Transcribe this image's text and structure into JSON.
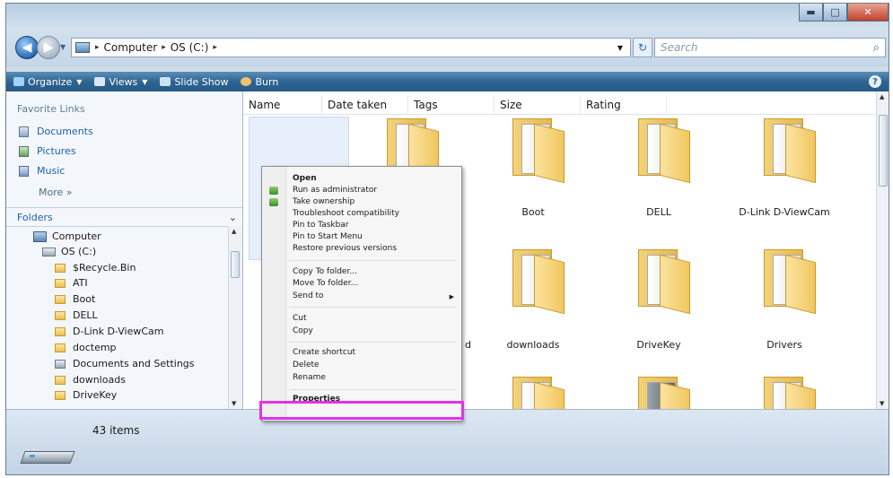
{
  "window": {
    "controls": {
      "minimize": "▬",
      "maximize": "□",
      "close": "✕"
    }
  },
  "address": {
    "back": "◀",
    "forward": "▶",
    "crumbs": [
      "Computer",
      "OS (C:)"
    ],
    "separator": "▸",
    "refresh": "↻",
    "search_placeholder": "Search",
    "search_icon": "⌕"
  },
  "toolbar": {
    "organize": "Organize",
    "views": "Views",
    "slideshow": "Slide Show",
    "burn": "Burn",
    "help": "?"
  },
  "sidebar": {
    "favorites_header": "Favorite Links",
    "favorites": [
      "Documents",
      "Pictures",
      "Music"
    ],
    "more": "More »",
    "folders_header": "Folders",
    "tree": [
      "Computer",
      "OS (C:)",
      "$Recycle.Bin",
      "ATI",
      "Boot",
      "DELL",
      "D-Link D-ViewCam",
      "doctemp",
      "Documents and Settings",
      "downloads",
      "DriveKey"
    ]
  },
  "columns": [
    "Name",
    "Date taken",
    "Tags",
    "Size",
    "Rating"
  ],
  "items": [
    {
      "row": 0,
      "col": 2,
      "label": "Boot"
    },
    {
      "row": 0,
      "col": 3,
      "label": "DELL"
    },
    {
      "row": 0,
      "col": 4,
      "label": "D-Link D-ViewCam"
    },
    {
      "row": 1,
      "col": 2,
      "label": "downloads"
    },
    {
      "row": 1,
      "col": 3,
      "label": "DriveKey"
    },
    {
      "row": 1,
      "col": 4,
      "label": "Drivers"
    }
  ],
  "partial_label": "d",
  "context_menu": {
    "open": "Open",
    "run_admin": "Run as administrator",
    "take_ownership": "Take ownership",
    "troubleshoot": "Troubleshoot compatibility",
    "pin_taskbar": "Pin to Taskbar",
    "pin_start": "Pin to Start Menu",
    "restore": "Restore previous versions",
    "copy_to": "Copy To folder...",
    "move_to": "Move To folder...",
    "send_to": "Send to",
    "cut": "Cut",
    "copy": "Copy",
    "create_shortcut": "Create shortcut",
    "delete": "Delete",
    "rename": "Rename",
    "properties": "Properties"
  },
  "details": {
    "count": "43 items"
  },
  "colors": {
    "highlight": "#e033e8",
    "toolbar": "#2f6592",
    "link": "#1f5fa8"
  }
}
